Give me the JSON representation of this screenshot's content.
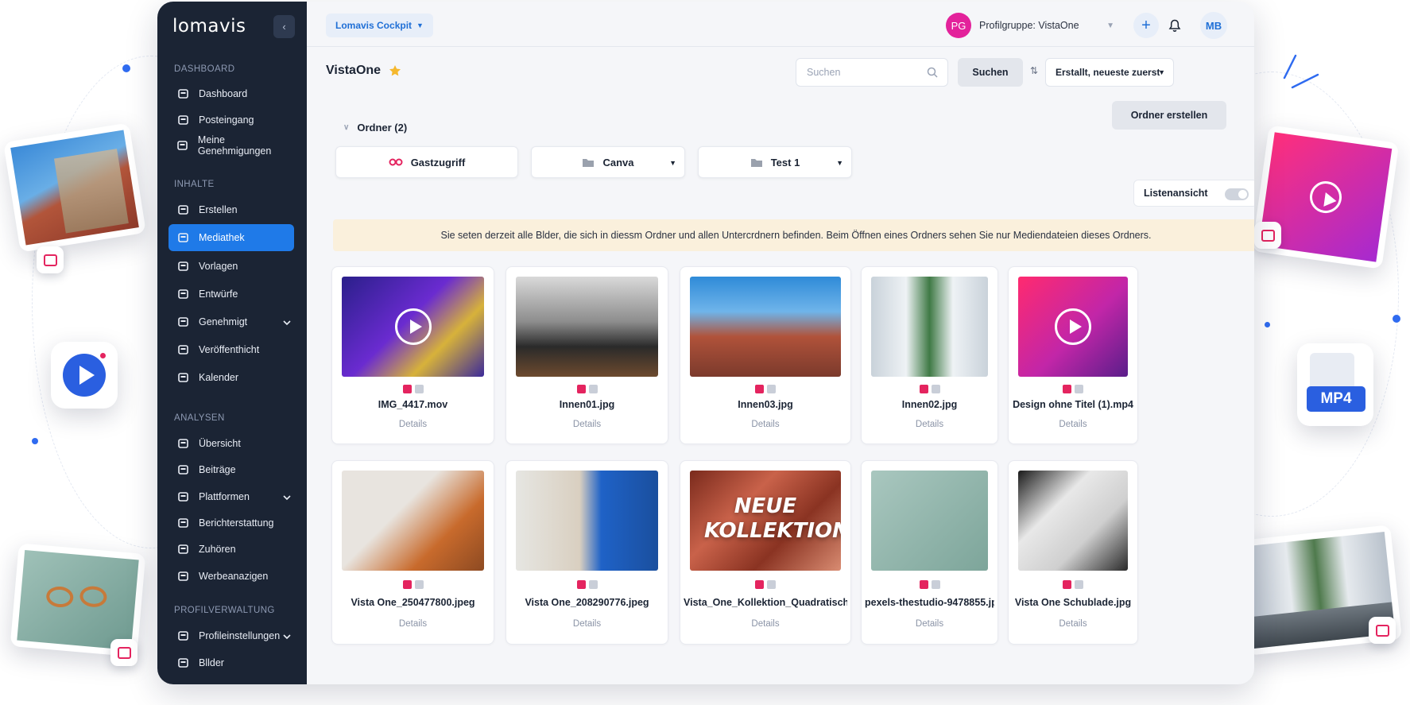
{
  "app": {
    "logo": "lomavis",
    "cockpit_label": "Lomavis Cockpit",
    "profile_group": "Profilgruppe: VistaOne",
    "profile_initials": "PG",
    "user_initials": "MB"
  },
  "sidebar": {
    "sections": [
      "DASHBOARD",
      "INHALTE",
      "ANALYSEN",
      "PROFILVERWALTUNG"
    ],
    "items": [
      {
        "label": "Dashboard",
        "icon": "dashboard-icon"
      },
      {
        "label": "Posteingang",
        "icon": "inbox-icon"
      },
      {
        "label": "Meine Genehmigungen",
        "icon": "approvals-icon"
      },
      {
        "label": "Erstellen",
        "icon": "create-icon"
      },
      {
        "label": "Mediathek",
        "icon": "media-library-icon",
        "active": true
      },
      {
        "label": "Vorlagen",
        "icon": "templates-icon"
      },
      {
        "label": "Entwürfe",
        "icon": "drafts-icon"
      },
      {
        "label": "Genehmigt",
        "icon": "approved-icon",
        "expandable": true
      },
      {
        "label": "Veröffenthicht",
        "icon": "published-icon"
      },
      {
        "label": "Kalender",
        "icon": "calendar-icon"
      },
      {
        "label": "Übersicht",
        "icon": "home-icon"
      },
      {
        "label": "Beiträge",
        "icon": "posts-icon"
      },
      {
        "label": "Plattformen",
        "icon": "platforms-icon",
        "expandable": true
      },
      {
        "label": "Berichterstattung",
        "icon": "reporting-icon"
      },
      {
        "label": "Zuhören",
        "icon": "listening-icon"
      },
      {
        "label": "Werbeanazigen",
        "icon": "ads-icon"
      },
      {
        "label": "Profileinstellungen",
        "icon": "profile-settings-icon",
        "expandable": true
      },
      {
        "label": "Bllder",
        "icon": "images-icon"
      }
    ]
  },
  "page": {
    "title": "VistaOne",
    "search_placeholder": "Suchen",
    "search_button": "Suchen",
    "sort_label": "Erstallt, neueste zuerst",
    "create_folder_button": "Ordner erstellen",
    "folders_heading": "Ordner (2)",
    "folders": [
      "Gastzugriff",
      "Canva",
      "Test 1"
    ],
    "list_view_label": "Listenansicht",
    "list_view_on": false,
    "info_text": "Sie seten derzeit alle Blder, die sich in diessm Ordner und allen Untercrdnern befinden. Beim Öffnen eines Ordners sehen Sie nur Mediendateien dieses Ordners.",
    "details_label": "Details"
  },
  "media": [
    {
      "name": "IMG_4417.mov",
      "video": true
    },
    {
      "name": "Innen01.jpg",
      "video": false
    },
    {
      "name": "Innen03.jpg",
      "video": false
    },
    {
      "name": "Innen02.jpg",
      "video": false
    },
    {
      "name": "Design ohne Titel (1).mp4",
      "video": true
    },
    {
      "name": "Vista One_250477800.jpeg",
      "video": false
    },
    {
      "name": "Vista One_208290776.jpeg",
      "video": false
    },
    {
      "name": "Vista_One_Kollektion_Quadratisch.jpg",
      "video": false,
      "overlay_text": "NEUE KOLLEKTION"
    },
    {
      "name": "pexels-thestudio-9478855.jpg",
      "video": false
    },
    {
      "name": "Vista One Schublade.jpg",
      "video": false
    }
  ],
  "decor": {
    "mp4_badge": "MP4"
  },
  "colors": {
    "sidebar_bg": "#1b2434",
    "accent": "#1f7ae8",
    "pink": "#e4245f",
    "banner": "#faf0dc"
  }
}
